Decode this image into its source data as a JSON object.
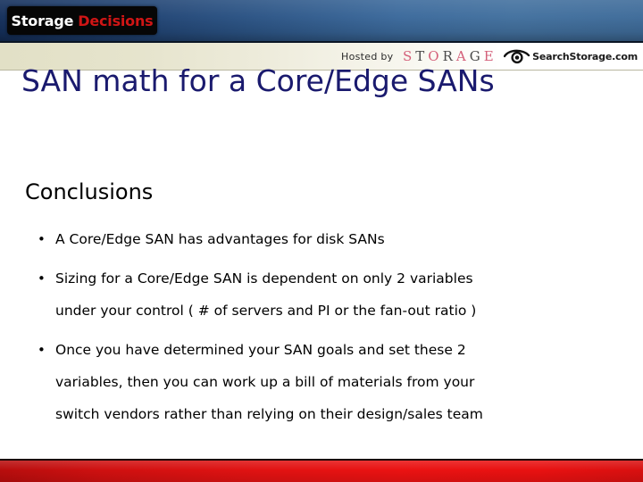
{
  "header": {
    "brand": {
      "word1": "Storage",
      "word2": "Decisions"
    },
    "hosted_by_label": "Hosted by",
    "storage_logo": {
      "letters": [
        "S",
        "T",
        "O",
        "R",
        "A",
        "G",
        "E"
      ],
      "text": "STORAGE"
    },
    "search_storage_logo": {
      "icon": "eye-icon",
      "text": "SearchStorage.com"
    },
    "colors": {
      "blue_dark": "#15305c",
      "blue_light": "#43719f",
      "brand_red": "#cf1515",
      "cream": "#e2e0c6"
    }
  },
  "slide": {
    "title": "SAN math for a Core/Edge SANs",
    "title_color": "#1a1a6e",
    "heading": "Conclusions",
    "bullet_marker": "•",
    "bullets": [
      {
        "lines": [
          "A Core/Edge SAN has advantages for disk SANs"
        ]
      },
      {
        "lines": [
          "Sizing for a Core/Edge SAN is dependent on only 2 variables",
          "under your control (  # of servers and PI or the fan-out ratio )"
        ]
      },
      {
        "lines": [
          "Once you have determined your SAN goals and set these 2",
          "variables, then you can work up a bill of materials from your",
          "switch vendors rather than relying on their design/sales team"
        ]
      }
    ]
  },
  "footer": {
    "color": "#e01212"
  }
}
